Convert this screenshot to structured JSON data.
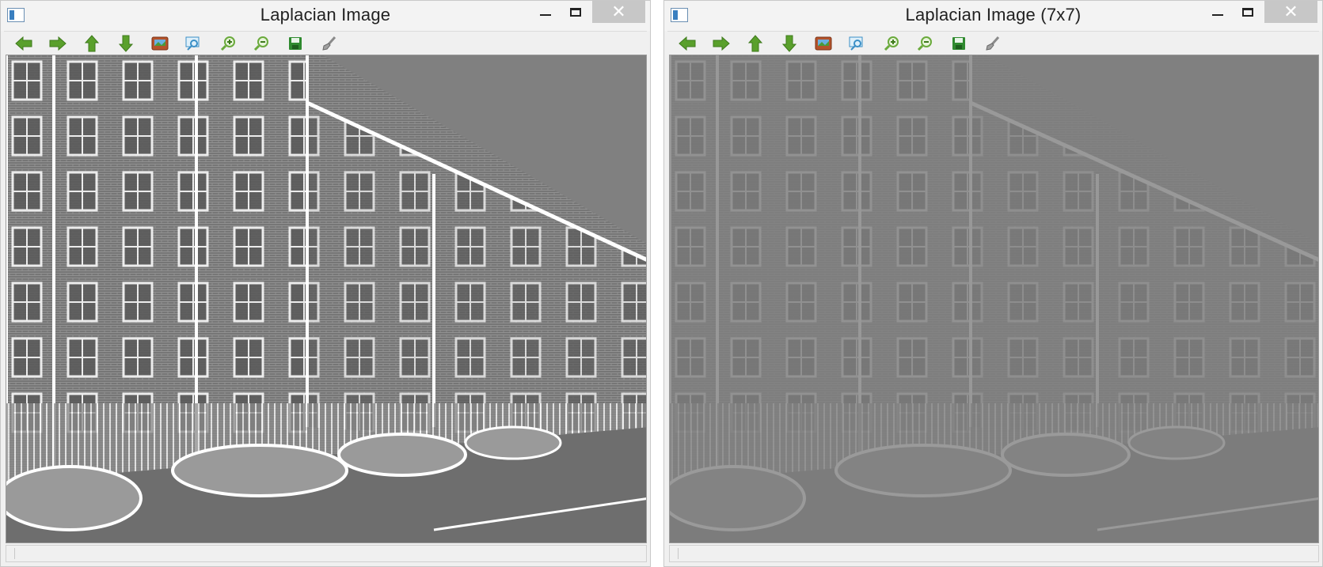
{
  "windows": {
    "left": {
      "title": "Laplacian Image",
      "contrast": "high"
    },
    "right": {
      "title": "Laplacian Image (7x7)",
      "contrast": "low"
    }
  },
  "window_controls": {
    "minimize_icon": "minimize-icon",
    "maximize_icon": "maximize-icon",
    "close_glyph": "✕"
  },
  "toolbar_icons": [
    {
      "name": "pan-left-icon",
      "color": "#5aa02c"
    },
    {
      "name": "pan-right-icon",
      "color": "#5aa02c"
    },
    {
      "name": "pan-up-icon",
      "color": "#5aa02c"
    },
    {
      "name": "pan-down-icon",
      "color": "#5aa02c"
    },
    {
      "name": "zoom-to-fit-icon",
      "color": "#b5532a"
    },
    {
      "name": "zoom-region-icon",
      "color": "#3b8fc6"
    },
    {
      "name": "zoom-in-icon",
      "color": "#6aaa3c"
    },
    {
      "name": "zoom-out-icon",
      "color": "#6aaa3c"
    },
    {
      "name": "save-icon",
      "color": "#2f8a2f"
    },
    {
      "name": "properties-brush-icon",
      "color": "#8a8a8a"
    }
  ],
  "colors": {
    "title_bar": "#f3f3f3",
    "close_button": "#c7c7c7",
    "laplacian_gray": "#808080"
  }
}
